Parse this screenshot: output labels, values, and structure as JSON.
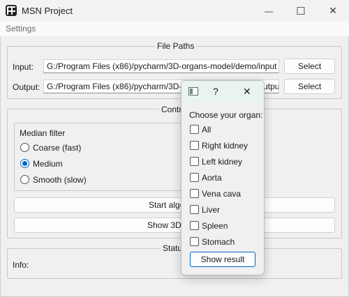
{
  "window": {
    "title": "MSN Project",
    "minimize_glyph": "—",
    "maximize_glyph": "☐",
    "close_glyph": "✕"
  },
  "menu": [
    "Settings"
  ],
  "file_paths": {
    "title": "File Paths",
    "input_label": "Input:",
    "input_value": "G:/Program Files (x86)/pycharm/3D-organs-model/demo/input",
    "output_label": "Output:",
    "output_value": "G:/Program Files (x86)/pycharm/3D-organs-model/demo/output",
    "select_input": "Select",
    "select_output": "Select"
  },
  "control": {
    "title_visible": "Contro",
    "median_filter_label": "Median filter",
    "options": [
      {
        "label": "Coarse (fast)",
        "checked": false
      },
      {
        "label": "Medium",
        "checked": true
      },
      {
        "label": "Smooth (slow)",
        "checked": false
      }
    ],
    "start_button_visible": "Start algo",
    "show3d_button_visible": "Show 3D m"
  },
  "status": {
    "title_visible": "Statu",
    "info_label": "Info:"
  },
  "dialog": {
    "help_glyph": "?",
    "close_glyph": "✕",
    "prompt": "Choose your organ:",
    "organs": [
      "All",
      "Right kidney",
      "Left kidney",
      "Aorta",
      "Vena cava",
      "Liver",
      "Spleen",
      "Stomach"
    ],
    "show_result": "Show result"
  },
  "colors": {
    "accent": "#0067c0",
    "window_bg": "#f0f0f0",
    "dialog_titlebar": "#e9f3f1"
  },
  "icons": {
    "app": "app-grid-icon",
    "dialog": "window-app-icon"
  }
}
